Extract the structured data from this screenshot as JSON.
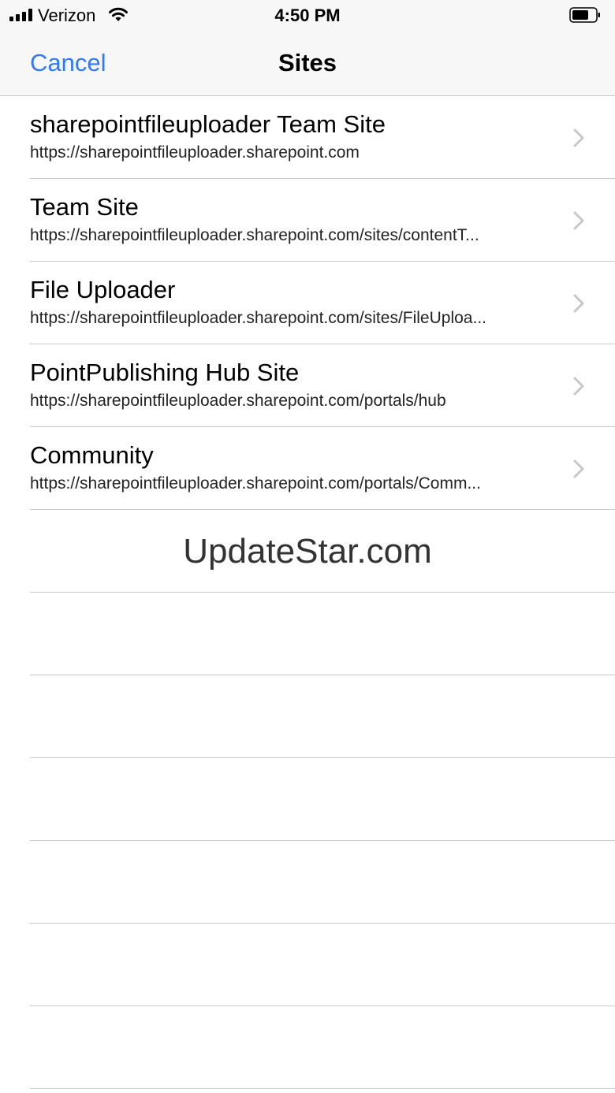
{
  "status_bar": {
    "carrier": "Verizon",
    "time": "4:50 PM"
  },
  "nav": {
    "cancel_label": "Cancel",
    "title": "Sites"
  },
  "sites": [
    {
      "title": "sharepointfileuploader Team Site",
      "url": "https://sharepointfileuploader.sharepoint.com"
    },
    {
      "title": "Team Site",
      "url": "https://sharepointfileuploader.sharepoint.com/sites/contentT..."
    },
    {
      "title": "File Uploader",
      "url": "https://sharepointfileuploader.sharepoint.com/sites/FileUploa..."
    },
    {
      "title": "PointPublishing Hub Site",
      "url": "https://sharepointfileuploader.sharepoint.com/portals/hub"
    },
    {
      "title": "Community",
      "url": "https://sharepointfileuploader.sharepoint.com/portals/Comm..."
    }
  ],
  "watermark": "UpdateStar.com",
  "colors": {
    "accent": "#3478f6",
    "separator": "#c8c7cc",
    "chevron": "#c7c7cc",
    "bar_background": "#f7f7f7"
  }
}
